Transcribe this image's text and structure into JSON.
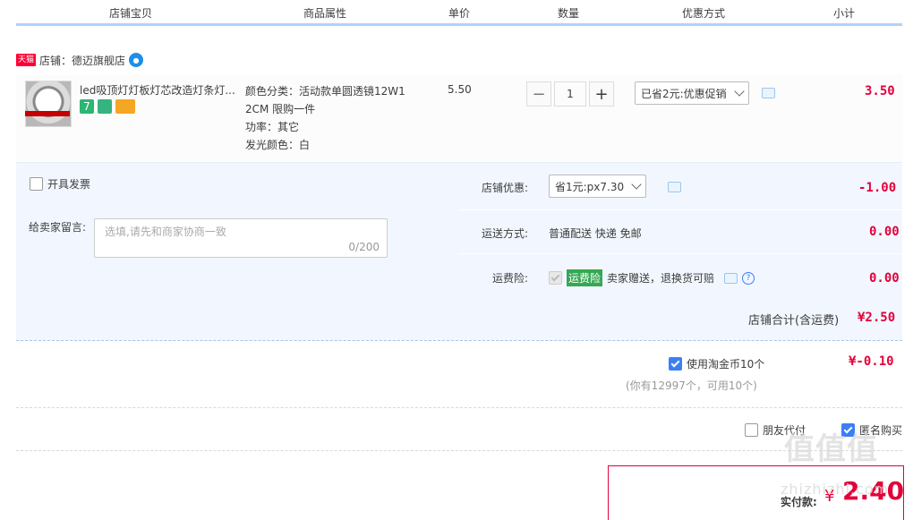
{
  "header": {
    "columns": [
      "店铺宝贝",
      "商品属性",
      "单价",
      "数量",
      "优惠方式",
      "小计"
    ]
  },
  "shop": {
    "badge": "天猫",
    "name": "店铺：德迈旗舰店"
  },
  "item": {
    "title": "led吸顶灯灯板灯芯改造灯条灯...",
    "attrs": [
      "颜色分类：活动款单圆透镜12W1",
      "2CM 限购一件",
      "功率：其它",
      "发光颜色：白"
    ],
    "unit_price": "5.50",
    "quantity": "1",
    "minus": "−",
    "plus": "+",
    "promo": "已省2元:优惠促销",
    "subtotal": "3.50",
    "service_badge_text": "7"
  },
  "invoice": {
    "label": "开具发票"
  },
  "message": {
    "label": "给卖家留言:",
    "placeholder": "选填,请先和商家协商一致",
    "counter": "0/200"
  },
  "shop_discount": {
    "label": "店铺优惠:",
    "option": "省1元:px7.30",
    "amount": "-1.00"
  },
  "shipping": {
    "label": "运送方式:",
    "value": "普通配送 快递 免邮",
    "amount": "0.00"
  },
  "insurance": {
    "label": "运费险:",
    "tag": "运费险",
    "value": "卖家赠送，退换货可赔",
    "help": "?",
    "amount": "0.00"
  },
  "shop_total": {
    "label": "店铺合计(含运费)",
    "amount": "¥2.50"
  },
  "coins": {
    "label": "使用淘金币10个",
    "amount": "¥-0.10",
    "note": "(你有12997个，可用10个)"
  },
  "options": {
    "friend_pay": "朋友代付",
    "anonymous": "匿名购买"
  },
  "pay": {
    "label": "实付款:",
    "currency": "¥",
    "amount": "2.40"
  },
  "watermark": {
    "logo": "值值值",
    "site": "zhizhizhi.com"
  },
  "colors": {
    "accent_red": "#e4003a",
    "header_line": "#b2d1ff",
    "panel_bg": "#f2f7ff",
    "checkbox_blue": "#3b7ff5"
  }
}
